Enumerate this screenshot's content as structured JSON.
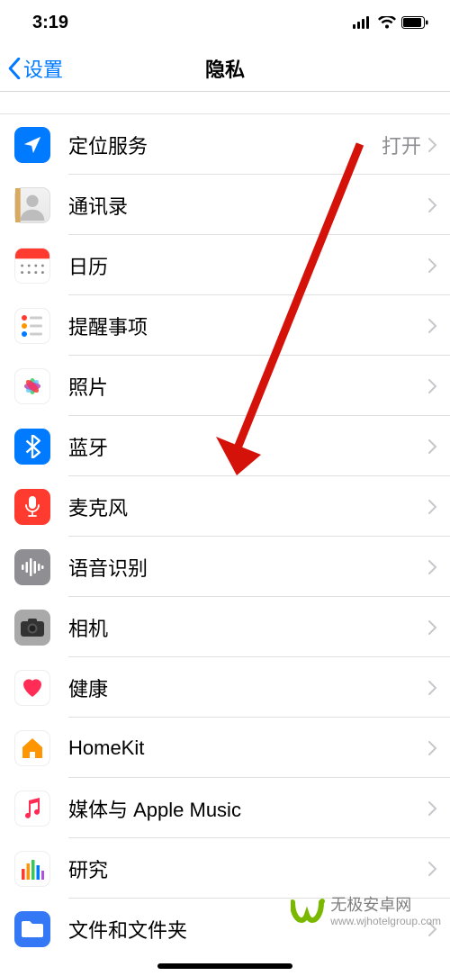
{
  "status": {
    "time": "3:19"
  },
  "nav": {
    "back": "设置",
    "title": "隐私"
  },
  "rows": [
    {
      "label": "定位服务",
      "value": "打开"
    },
    {
      "label": "通讯录",
      "value": ""
    },
    {
      "label": "日历",
      "value": ""
    },
    {
      "label": "提醒事项",
      "value": ""
    },
    {
      "label": "照片",
      "value": ""
    },
    {
      "label": "蓝牙",
      "value": ""
    },
    {
      "label": "麦克风",
      "value": ""
    },
    {
      "label": "语音识别",
      "value": ""
    },
    {
      "label": "相机",
      "value": ""
    },
    {
      "label": "健康",
      "value": ""
    },
    {
      "label": "HomeKit",
      "value": ""
    },
    {
      "label": "媒体与 Apple Music",
      "value": ""
    },
    {
      "label": "研究",
      "value": ""
    },
    {
      "label": "文件和文件夹",
      "value": ""
    }
  ],
  "watermark": {
    "brand": "无极安卓网",
    "url": "www.wjhotelgroup.com"
  }
}
